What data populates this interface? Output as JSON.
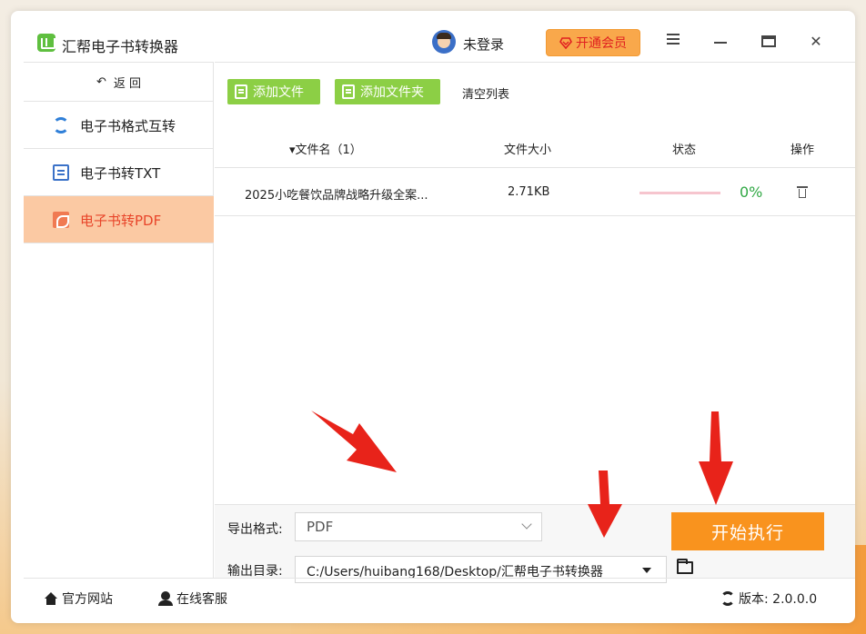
{
  "app": {
    "title": "汇帮电子书转换器",
    "login_status": "未登录",
    "vip_button": "开通会员"
  },
  "sidebar": {
    "back_label": "返 回",
    "items": [
      {
        "label": "电子书格式互转",
        "icon": "sync-icon",
        "active": false
      },
      {
        "label": "电子书转TXT",
        "icon": "txt-document-icon",
        "active": false
      },
      {
        "label": "电子书转PDF",
        "icon": "pdf-icon",
        "active": true
      }
    ]
  },
  "toolbar": {
    "add_file": "添加文件",
    "add_folder": "添加文件夹",
    "clear_list": "清空列表"
  },
  "table": {
    "columns": {
      "name": "▾文件名（1）",
      "size": "文件大小",
      "status": "状态",
      "action": "操作"
    },
    "rows": [
      {
        "name": "2025小吃餐饮品牌战略升级全案...",
        "size": "2.71KB",
        "progress_text": "0%",
        "progress": 0
      }
    ]
  },
  "settings": {
    "format_label": "导出格式:",
    "format_value": "PDF",
    "dir_label": "输出目录:",
    "dir_value": "C:/Users/huibang168/Desktop/汇帮电子书转换器",
    "start_button": "开始执行"
  },
  "footer": {
    "website": "官方网站",
    "service": "在线客服",
    "version": "版本:  2.0.0.0"
  },
  "colors": {
    "accent_green": "#8ccf45",
    "accent_orange": "#f9931e",
    "active_item_bg": "#fbc9a3",
    "active_item_text": "#e8452a",
    "progress_green": "#31a845",
    "annotation_red": "#e8231a"
  }
}
